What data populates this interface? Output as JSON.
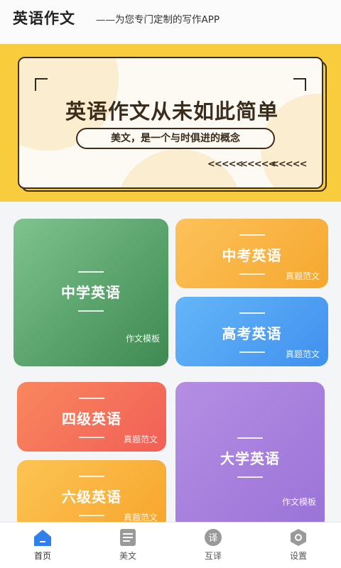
{
  "header": {
    "title": "英语作文",
    "slogan": "——为您专门定制的写作APP"
  },
  "banner": {
    "headline": "英语作文从未如此简单",
    "tagline": "美文，是一个与时俱进的概念",
    "arrows": [
      "<<<<<",
      "<<<<<",
      "<<<<<"
    ]
  },
  "categories": [
    {
      "name": "中学英语",
      "sub": "作文模板",
      "colors": [
        "#7fc38e",
        "#3f8a52"
      ]
    },
    {
      "name": "中考英语",
      "sub": "真题范文",
      "colors": [
        "#fcc25a",
        "#f6a72e"
      ]
    },
    {
      "name": "高考英语",
      "sub": "真题范文",
      "colors": [
        "#64b6f8",
        "#4090ef"
      ]
    },
    {
      "name": "四级英语",
      "sub": "真题范文",
      "colors": [
        "#f9875e",
        "#f15f56"
      ]
    },
    {
      "name": "六级英语",
      "sub": "真题范文",
      "colors": [
        "#fcc453",
        "#f7a52c"
      ]
    },
    {
      "name": "大学英语",
      "sub": "作文模板",
      "colors": [
        "#b58ee3",
        "#9a73d8"
      ]
    }
  ],
  "tabbar": {
    "active_color": "#2f80ed",
    "items": [
      {
        "label": "首页",
        "icon": "home-icon",
        "active": true
      },
      {
        "label": "美文",
        "icon": "article-icon",
        "active": false
      },
      {
        "label": "互译",
        "icon": "translate-icon",
        "active": false
      },
      {
        "label": "设置",
        "icon": "settings-icon",
        "active": false
      }
    ]
  }
}
